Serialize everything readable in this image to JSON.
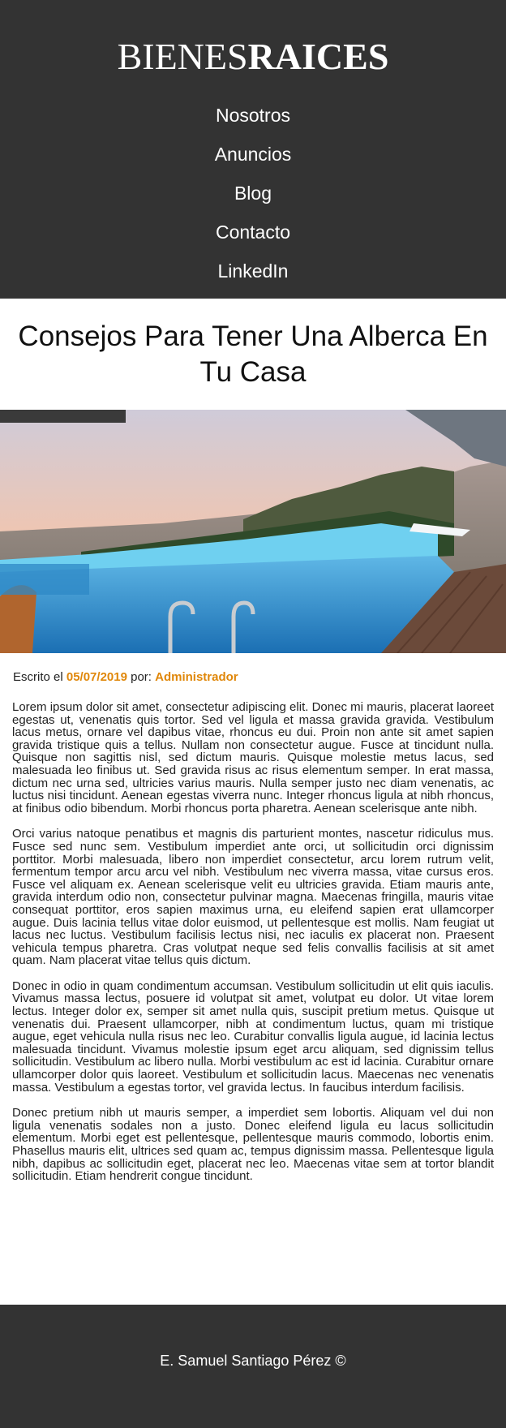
{
  "header": {
    "logo_light": "BIENES",
    "logo_bold": "RAICES",
    "nav": [
      {
        "label": "Nosotros"
      },
      {
        "label": "Anuncios"
      },
      {
        "label": "Blog"
      },
      {
        "label": "Contacto"
      },
      {
        "label": "LinkedIn"
      }
    ]
  },
  "article": {
    "title": "Consejos Para Tener Una Alberca En Tu Casa",
    "byline_prefix": "Escrito el ",
    "date": "05/07/2019",
    "byline_middle": " por: ",
    "author": "Administrador",
    "paragraphs": [
      "Lorem ipsum dolor sit amet, consectetur adipiscing elit. Donec mi mauris, placerat laoreet egestas ut, venenatis quis tortor. Sed vel ligula et massa gravida gravida. Vestibulum lacus metus, ornare vel dapibus vitae, rhoncus eu dui. Proin non ante sit amet sapien gravida tristique quis a tellus. Nullam non consectetur augue. Fusce at tincidunt nulla. Quisque non sagittis nisl, sed dictum mauris. Quisque molestie metus lacus, sed malesuada leo finibus ut. Sed gravida risus ac risus elementum semper. In erat massa, dictum nec urna sed, ultricies varius mauris. Nulla semper justo nec diam venenatis, ac luctus nisi tincidunt. Aenean egestas viverra nunc. Integer rhoncus ligula at nibh rhoncus, at finibus odio bibendum. Morbi rhoncus porta pharetra. Aenean scelerisque ante nibh.",
      "Orci varius natoque penatibus et magnis dis parturient montes, nascetur ridiculus mus. Fusce sed nunc sem. Vestibulum imperdiet ante orci, ut sollicitudin orci dignissim porttitor. Morbi malesuada, libero non imperdiet consectetur, arcu lorem rutrum velit, fermentum tempor arcu arcu vel nibh. Vestibulum nec viverra massa, vitae cursus eros. Fusce vel aliquam ex. Aenean scelerisque velit eu ultricies gravida. Etiam mauris ante, gravida interdum odio non, consectetur pulvinar magna. Maecenas fringilla, mauris vitae consequat porttitor, eros sapien maximus urna, eu eleifend sapien erat ullamcorper augue. Duis lacinia tellus vitae dolor euismod, ut pellentesque est mollis. Nam feugiat ut lacus nec luctus. Vestibulum facilisis lectus nisi, nec iaculis ex placerat non. Praesent vehicula tempus pharetra. Cras volutpat neque sed felis convallis facilisis at sit amet quam. Nam placerat vitae tellus quis dictum.",
      "Donec in odio in quam condimentum accumsan. Vestibulum sollicitudin ut elit quis iaculis. Vivamus massa lectus, posuere id volutpat sit amet, volutpat eu dolor. Ut vitae lorem lectus. Integer dolor ex, semper sit amet nulla quis, suscipit pretium metus. Quisque ut venenatis dui. Praesent ullamcorper, nibh at condimentum luctus, quam mi tristique augue, eget vehicula nulla risus nec leo. Curabitur convallis ligula augue, id lacinia lectus malesuada tincidunt. Vivamus molestie ipsum eget arcu aliquam, sed dignissim tellus sollicitudin. Vestibulum ac libero nulla. Morbi vestibulum ac est id lacinia. Curabitur ornare ullamcorper dolor quis laoreet. Vestibulum et sollicitudin lacus. Maecenas nec venenatis massa. Vestibulum a egestas tortor, vel gravida lectus. In faucibus interdum facilisis.",
      "Donec pretium nibh ut mauris semper, a imperdiet sem lobortis. Aliquam vel dui non ligula venenatis sodales non a justo. Donec eleifend ligula eu lacus sollicitudin elementum. Morbi eget est pellentesque, pellentesque mauris commodo, lobortis enim. Phasellus mauris elit, ultrices sed quam ac, tempus dignissim massa. Pellentesque ligula nibh, dapibus ac sollicitudin eget, placerat nec leo. Maecenas vitae sem at tortor blandit sollicitudin. Etiam hendrerit congue tincidunt."
    ]
  },
  "footer": {
    "text": "E. Samuel Santiago Pérez ©"
  },
  "colors": {
    "header_bg": "#333333",
    "accent": "#e08709"
  }
}
